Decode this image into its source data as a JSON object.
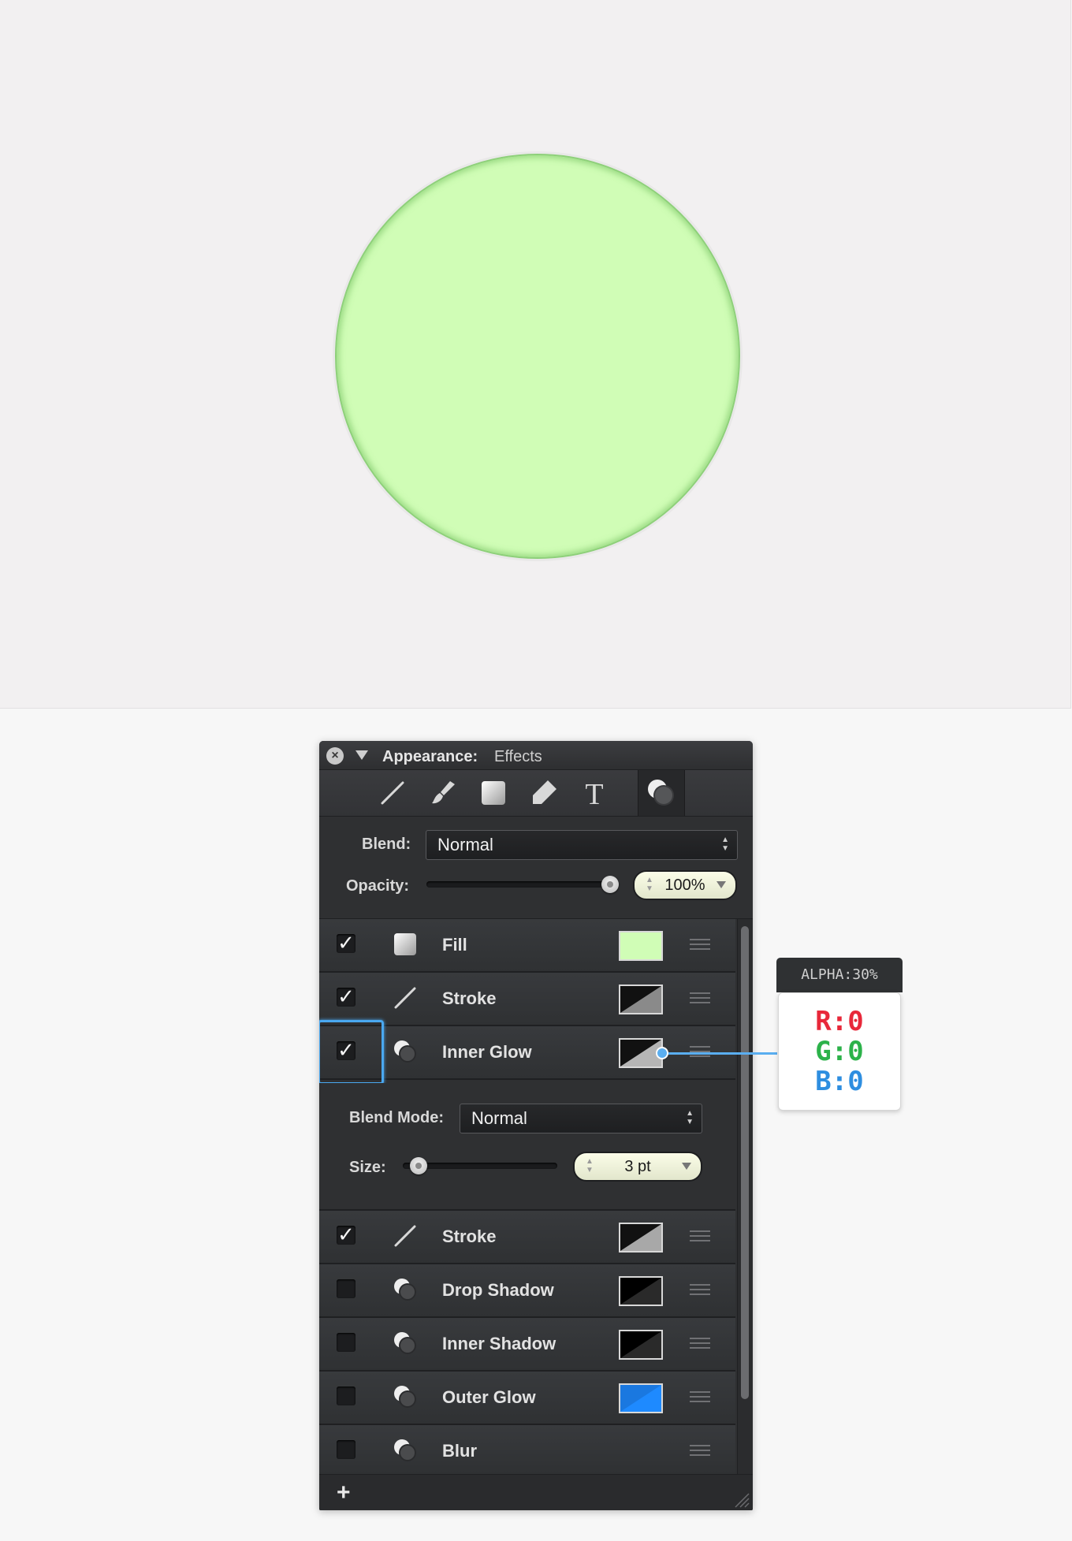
{
  "panel": {
    "title": "Appearance:",
    "subtitle": "Effects",
    "toolbar": [
      "stroke-tool-icon",
      "brush-tool-icon",
      "fill-tool-icon",
      "tag-tool-icon",
      "text-tool-icon",
      "effects-tool-icon"
    ],
    "blend_label": "Blend:",
    "blend_value": "Normal",
    "opacity_label": "Opacity:",
    "opacity_value": "100%",
    "opacity_fraction": 1.0
  },
  "effects": [
    {
      "label": "Fill",
      "checked": true,
      "swatch": "#d0fdb6"
    },
    {
      "label": "Stroke",
      "checked": true,
      "swatch": "stroke-gray"
    },
    {
      "label": "Inner Glow",
      "checked": true,
      "swatch": "stroke-gray"
    },
    {
      "label": "Stroke",
      "checked": true,
      "swatch": "stroke-gray"
    },
    {
      "label": "Drop Shadow",
      "checked": false,
      "swatch": "black"
    },
    {
      "label": "Inner Shadow",
      "checked": false,
      "swatch": "black"
    },
    {
      "label": "Outer Glow",
      "checked": false,
      "swatch": "#1e8aff"
    },
    {
      "label": "Blur",
      "checked": false,
      "swatch": ""
    }
  ],
  "inner_glow": {
    "blend_mode_label": "Blend Mode:",
    "blend_mode_value": "Normal",
    "size_label": "Size:",
    "size_value": "3 pt",
    "size_fraction": 0.05
  },
  "callout": {
    "alpha": "ALPHA:30%",
    "r": "R:0",
    "g": "G:0",
    "b": "B:0"
  },
  "colors": {
    "circle_fill": "#d0fdb6",
    "circle_stroke": "#8ed07a",
    "accent": "#4aa8f0",
    "r": "#e8283a",
    "g": "#2cb24a",
    "b": "#2e8ee0"
  },
  "footer": {
    "add_label": "+"
  }
}
